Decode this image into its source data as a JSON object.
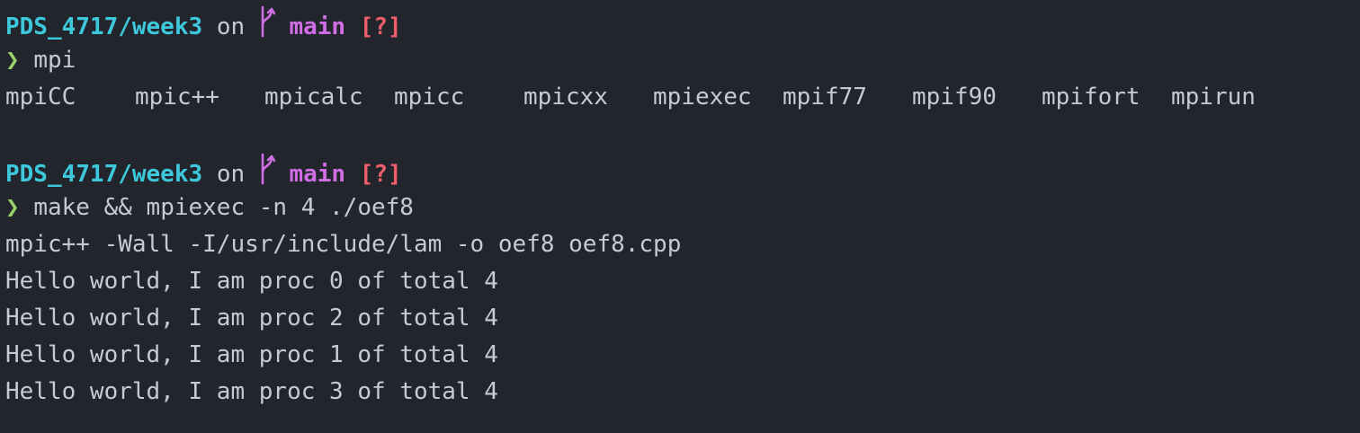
{
  "prompt": {
    "path": "PDS_4717/week3",
    "on": "on",
    "branch_icon": "git-branch-icon",
    "branch": "main",
    "status": "[?]",
    "char": "❯"
  },
  "colors": {
    "background": "#22252c",
    "text": "#c6cad1",
    "path": "#3ec8dc",
    "branch": "#d16ee6",
    "status": "#ef5f6b",
    "prompt_char": "#9ad16a"
  },
  "blocks": [
    {
      "command": "mpi",
      "completions": [
        "mpiCC",
        "mpic++",
        "mpicalc",
        "mpicc",
        "mpicxx",
        "mpiexec",
        "mpif77",
        "mpif90",
        "mpifort",
        "mpirun"
      ]
    },
    {
      "command": "make && mpiexec -n 4 ./oef8",
      "output": [
        "mpic++ -Wall -I/usr/include/lam -o oef8 oef8.cpp",
        "Hello world, I am proc 0 of total 4",
        "Hello world, I am proc 2 of total 4",
        "Hello world, I am proc 1 of total 4",
        "Hello world, I am proc 3 of total 4"
      ]
    }
  ]
}
